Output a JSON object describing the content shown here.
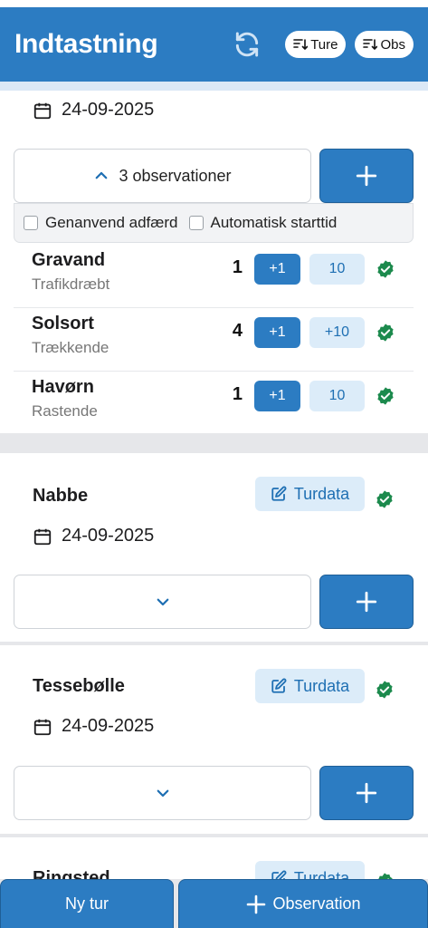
{
  "header": {
    "title": "Indtastning",
    "ture_label": "Ture",
    "obs_label": "Obs"
  },
  "trips": [
    {
      "name": "",
      "date": "24-09-2025",
      "observations_toggle": "3 observationer",
      "options": {
        "reuse_behavior": "Genanvend adfærd",
        "auto_start": "Automatisk starttid"
      },
      "observations": [
        {
          "species": "Gravand",
          "behavior": "Trafikdræbt",
          "count": "1",
          "plus1": "+1",
          "plus10": "10"
        },
        {
          "species": "Solsort",
          "behavior": "Trækkende",
          "count": "4",
          "plus1": "+1",
          "plus10": "+10"
        },
        {
          "species": "Havørn",
          "behavior": "Rastende",
          "count": "1",
          "plus1": "+1",
          "plus10": "10"
        }
      ]
    },
    {
      "name": "Nabbe",
      "date": "24-09-2025",
      "turdata_label": "Turdata"
    },
    {
      "name": "Tessebølle",
      "date": "24-09-2025",
      "turdata_label": "Turdata"
    },
    {
      "name": "Ringsted",
      "turdata_label": "Turdata"
    }
  ],
  "footer": {
    "new_trip": "Ny tur",
    "observation": "Observation"
  },
  "colors": {
    "primary": "#2c7cc2",
    "light_blue": "#dcecf9",
    "success": "#1c8a4d"
  }
}
